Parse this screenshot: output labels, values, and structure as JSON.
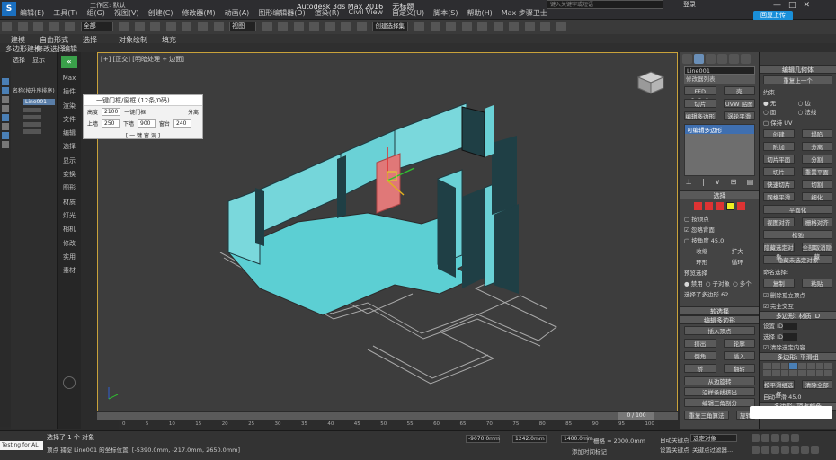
{
  "app": {
    "title": "Autodesk 3ds Max 2016",
    "document": "无标题",
    "workspace": "工作区: 默认",
    "search_placeholder": "键入关键字或短语",
    "sign_in": "登录",
    "upload": "回复上传"
  },
  "menu": [
    "编辑(E)",
    "工具(T)",
    "组(G)",
    "视图(V)",
    "创建(C)",
    "修改器(M)",
    "动画(A)",
    "图形编辑器(D)",
    "渲染(R)",
    "Civil View",
    "自定义(U)",
    "脚本(S)",
    "帮助(H)",
    "Max 步骤卫士"
  ],
  "toolbar": {
    "selection_filter": "全部",
    "view_dropdown": "视图",
    "selection_set": "创建选择集"
  },
  "ribbon": {
    "tab1": "建模",
    "tab2": "自由形式",
    "tab3": "选择",
    "tab4": "对象绘制",
    "tab5": "填充",
    "sub1": "多边形建模",
    "sub2": "修改选择",
    "sub3": "编辑"
  },
  "scene_explorer": {
    "tabs": [
      "选择",
      "显示"
    ],
    "root": "名称(按升序排序)",
    "selected": "Line001"
  },
  "command_panel_labels": [
    "Max",
    "插件",
    "渲染",
    "文件",
    "编辑",
    "选择",
    "显示",
    "变换",
    "图形",
    "材质",
    "灯光",
    "相机",
    "修改",
    "实用",
    "素材"
  ],
  "viewport": {
    "label": "[+] [正交] [明暗处理 + 边面]"
  },
  "dialog": {
    "title": "一键门框/窗框 (12条/0码)",
    "row1_label": "高度",
    "row1_value": "2100",
    "row1_btn": "一键门框",
    "row1_right": "分离",
    "row2_label": "上墙",
    "row2_value": "250",
    "row2_mid": "下墙",
    "row2_mid_value": "900",
    "row2_right": "窗台",
    "row2_right_value": "240",
    "row3": "[ 一 键 窗 洞 ]"
  },
  "modifier_panel": {
    "object_name": "Line001",
    "modifier_list": "修改器列表",
    "buttons": [
      "FFD 2x2x2",
      "壳",
      "切片",
      "UVW 贴图",
      "编辑多边形",
      "涡轮平滑"
    ],
    "stack_item": "可编辑多边形",
    "selection_header": "选择",
    "by_vertex": "按顶点",
    "ignore_backfacing": "忽略背面",
    "by_angle": "按角度",
    "angle_value": "45.0",
    "shrink": "收缩",
    "grow": "扩大",
    "ring": "环形",
    "loop": "循环",
    "preview_selection": "预览选择",
    "preview_options": [
      "禁用",
      "子对象",
      "多个"
    ],
    "selected_count": "选择了多边形 62",
    "soft_selection": "软选择",
    "edit_polygons": "编辑多边形",
    "insert_vertex": "插入顶点",
    "extrude": "挤出",
    "outline": "轮廓",
    "bevel": "倒角",
    "inset": "插入",
    "bridge": "桥",
    "flip": "翻转",
    "from_edge": "从边旋转",
    "along_spline": "沿样条线挤出",
    "edit_tri": "编辑三角剖分",
    "retriangulate": "重复三角算法",
    "turn": "旋转"
  },
  "right_panel": {
    "edit_geometry": "编辑几何体",
    "repeat_last": "重复上一个",
    "constraints": "约束",
    "none": "无",
    "edge": "边",
    "face": "面",
    "normal": "法线",
    "preserve_uvs": "保持 UV",
    "create": "创建",
    "collapse": "塌陷",
    "attach": "附加",
    "detach": "分离",
    "slice_plane": "切片平面",
    "split": "分割",
    "slice": "切片",
    "reset_plane": "重置平面",
    "quickslice": "快速切片",
    "cut": "切割",
    "msmooth": "网格平滑",
    "tessellate": "细化",
    "planarize": "平面化",
    "view_align": "视图对齐",
    "grid_align": "栅格对齐",
    "relax": "松弛",
    "hide_selected": "隐藏选定对象",
    "unhide_all": "全部取消隐藏",
    "hide_unselected": "隐藏未选定对象",
    "named_selections": "命名选择:",
    "copy": "复制",
    "paste": "粘贴",
    "delete_isolated": "删除孤立顶点",
    "full_interactivity": "完全交互",
    "material_ids": "多边形: 材质 ID",
    "set_id": "设置 ID",
    "select_id": "选择 ID",
    "clear_selection": "清除选定内容",
    "smoothing_groups": "多边形: 平滑组",
    "select_by_sg": "按平滑组选择",
    "clear_all": "清除全部",
    "auto_smooth": "自动平滑",
    "auto_smooth_value": "45.0",
    "vertex_colors": "多边形: 顶点颜色"
  },
  "timeline": {
    "frame": "0 / 100",
    "ticks": [
      "0",
      "5",
      "10",
      "15",
      "20",
      "25",
      "30",
      "35",
      "40",
      "45",
      "50",
      "55",
      "60",
      "65",
      "70",
      "75",
      "80",
      "85",
      "90",
      "95",
      "100"
    ]
  },
  "status": {
    "selected": "选择了 1 个 对象",
    "prompt": "顶点 捕捉 Line001 的坐标位置: [-5390.0mm, -217.0mm, 2650.0mm]",
    "testing": "Testing for AL",
    "x": "-9070.0mm",
    "y": "1242.0mm",
    "z": "1400.0mm",
    "grid": "栅格 = 2000.0mm",
    "add_time_tag": "添加时间标记",
    "auto_key": "自动关键点",
    "selected_obj": "选定对象",
    "set_key": "设置关键点",
    "key_filters": "关键点过滤器..."
  }
}
